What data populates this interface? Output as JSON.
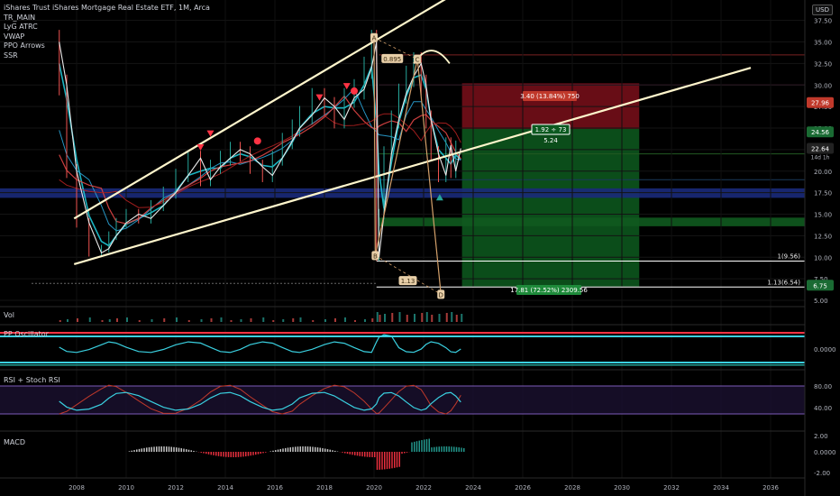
{
  "header": {
    "title": "iShares Trust iShares Mortgage Real Estate ETF, 1M, Arca",
    "indicators": [
      "TR_MAIN",
      "LyG ATRC",
      "VWAP",
      "PPO Arrows",
      "SSR"
    ],
    "currency": "USD"
  },
  "panes": {
    "volume": "Vol",
    "ppo": "PP Oscillator",
    "rsi": "RSI + Stoch RSI",
    "macd": "MACD"
  },
  "colors": {
    "background": "#000000",
    "price_line": "#e8e8e8",
    "wedge": "#fff6cc",
    "ema_cyan": "#1ec8d6",
    "ema_red": "#e04545",
    "rsi": "#3ad0e0",
    "stoch": "#c0392b",
    "macd_up": "#d8d8d8",
    "macd_down": "#ff3344",
    "macd_pos": "#26a69a",
    "short_risk": "#7a0f1a",
    "short_reward": "#0d5a1e",
    "zone_blue": "#1a2a7a",
    "zone_green": "#0f5a1f"
  },
  "chart_data": {
    "type": "line",
    "title": "iShares Trust iShares Mortgage Real Estate ETF, 1M, Arca",
    "scale": "log",
    "x": [
      2007.3,
      2007.6,
      2008.0,
      2008.5,
      2009.0,
      2009.3,
      2009.6,
      2010.0,
      2010.5,
      2011.0,
      2011.5,
      2012.0,
      2012.5,
      2013.0,
      2013.4,
      2013.8,
      2014.2,
      2014.6,
      2015.0,
      2015.5,
      2015.9,
      2016.3,
      2016.7,
      2017.0,
      2017.5,
      2018.0,
      2018.4,
      2018.8,
      2019.2,
      2019.6,
      2019.9,
      2020.1,
      2020.2,
      2020.4,
      2020.7,
      2021.0,
      2021.3,
      2021.6,
      2021.9,
      2022.1,
      2022.3,
      2022.6,
      2022.9,
      2023.1,
      2023.3,
      2023.5
    ],
    "values": [
      35.0,
      30.0,
      20.0,
      14.0,
      10.5,
      11.0,
      12.5,
      14.0,
      15.0,
      14.5,
      16.0,
      17.5,
      19.5,
      21.5,
      19.0,
      20.5,
      21.5,
      22.5,
      22.0,
      20.5,
      19.5,
      21.5,
      23.5,
      25.0,
      26.5,
      28.5,
      27.5,
      26.0,
      28.5,
      29.5,
      32.0,
      35.0,
      10.0,
      15.0,
      22.0,
      26.0,
      29.0,
      31.0,
      32.5,
      30.0,
      26.0,
      22.0,
      19.5,
      23.0,
      20.0,
      22.64
    ],
    "last_price": "22.64",
    "countdown": "14d 1h",
    "y_ticks": [
      "37.50",
      "35.00",
      "32.50",
      "30.00",
      "27.50",
      "25.00",
      "22.50",
      "20.00",
      "17.50",
      "15.00",
      "12.50",
      "10.00",
      "7.50",
      "5.00"
    ],
    "x_ticks": [
      "2008",
      "2010",
      "2012",
      "2014",
      "2016",
      "2018",
      "2020",
      "2022",
      "2024",
      "2026",
      "2028",
      "2030",
      "2032",
      "2034",
      "2036"
    ],
    "price_labels": {
      "top_right": "27.96",
      "middle": "24.56",
      "bottom": "6.75"
    },
    "position": {
      "risk_label": "3.40 (13.84%) 750",
      "ratio_label": "1.92 ÷ 73",
      "ratio_sub": "5.24",
      "reward_label": "17.81 (72.52%) 2309.56"
    },
    "fib_labels": {
      "level_1": "1(9.56)",
      "level_113": "1.13(6.54)",
      "ratio_0895": "0.895",
      "ratio_113": "1.13"
    },
    "pattern_points": [
      "A",
      "B",
      "C",
      "D"
    ],
    "ppo": {
      "y_tick": "0.0000"
    },
    "rsi": {
      "y_ticks": [
        "80.00",
        "40.00"
      ]
    },
    "macd": {
      "y_ticks": [
        "2.00",
        "0.0000",
        "-2.00"
      ]
    }
  }
}
